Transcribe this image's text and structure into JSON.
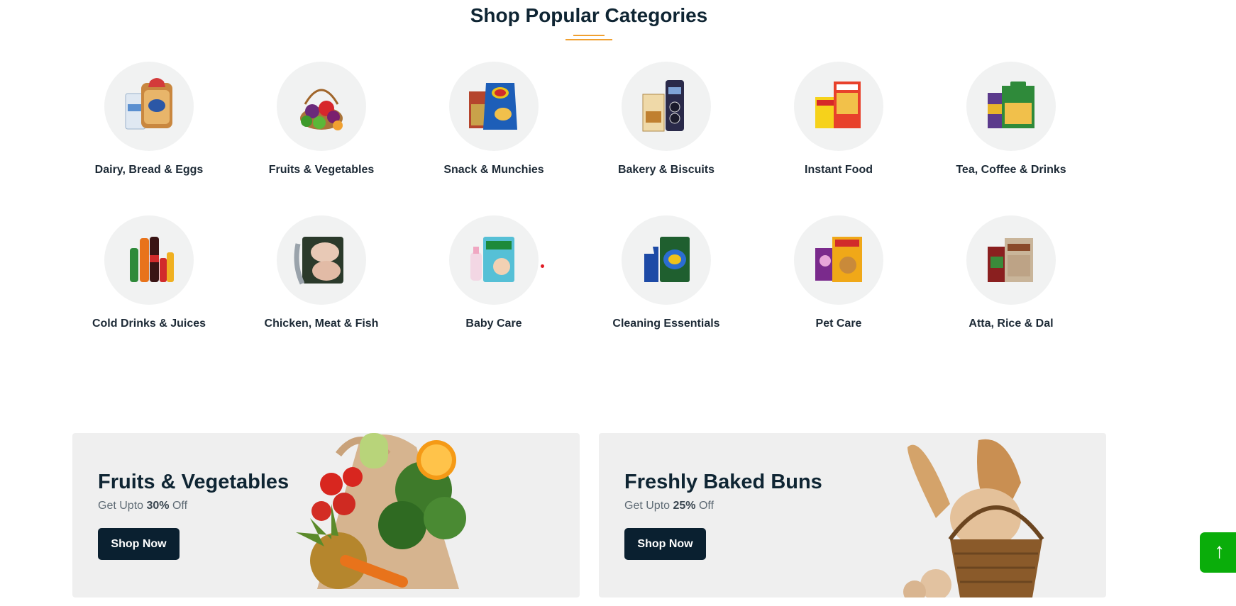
{
  "section": {
    "title": "Shop Popular Categories"
  },
  "categories": [
    {
      "label": "Dairy, Bread & Eggs",
      "icon": "dairy-bread-eggs-icon"
    },
    {
      "label": "Fruits & Vegetables",
      "icon": "fruits-vegetables-icon"
    },
    {
      "label": "Snack & Munchies",
      "icon": "snack-munchies-icon"
    },
    {
      "label": "Bakery & Biscuits",
      "icon": "bakery-biscuits-icon"
    },
    {
      "label": "Instant Food",
      "icon": "instant-food-icon"
    },
    {
      "label": "Tea, Coffee & Drinks",
      "icon": "tea-coffee-drinks-icon"
    },
    {
      "label": "Cold Drinks & Juices",
      "icon": "cold-drinks-juices-icon"
    },
    {
      "label": "Chicken, Meat & Fish",
      "icon": "chicken-meat-fish-icon"
    },
    {
      "label": "Baby Care",
      "icon": "baby-care-icon"
    },
    {
      "label": "Cleaning Essentials",
      "icon": "cleaning-essentials-icon"
    },
    {
      "label": "Pet Care",
      "icon": "pet-care-icon"
    },
    {
      "label": "Atta, Rice & Dal",
      "icon": "atta-rice-dal-icon"
    }
  ],
  "banners": [
    {
      "title": "Fruits & Vegetables",
      "subtitle_prefix": "Get Upto ",
      "discount": "30%",
      "subtitle_suffix": " Off",
      "button_label": "Shop Now"
    },
    {
      "title": "Freshly Baked Buns",
      "subtitle_prefix": "Get Upto ",
      "discount": "25%",
      "subtitle_suffix": " Off",
      "button_label": "Shop Now"
    }
  ],
  "scroll_top": {
    "icon": "arrow-up-icon",
    "glyph": "↑"
  },
  "colors": {
    "accent_underline": "#f0a030",
    "button_dark": "#0a2030",
    "scroll_top_green": "#0aad0a",
    "circle_bg": "#f1f2f2"
  }
}
